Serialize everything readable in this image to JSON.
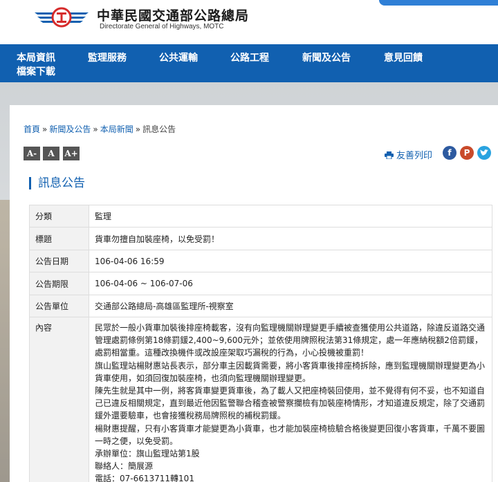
{
  "header": {
    "title_zh": "中華民國交通部公路總局",
    "title_en": "Directorate General of Highways, MOTC"
  },
  "nav": {
    "items": [
      "本局資訊",
      "監理服務",
      "公共運輸",
      "公路工程",
      "新聞及公告",
      "意見回饋",
      "檔案下載"
    ]
  },
  "breadcrumb": {
    "items": [
      "首頁",
      "新聞及公告",
      "本局新聞",
      "訊息公告"
    ],
    "sep": "»"
  },
  "toolbar": {
    "font_small": "A-",
    "font_medium": "A",
    "font_large": "A+",
    "print_label": "友善列印"
  },
  "page_title": "訊息公告",
  "info": {
    "category_label": "分類",
    "category_value": "監理",
    "title_label": "標題",
    "title_value": "貨車勿擅自加裝座椅，以免受罰！",
    "date_label": "公告日期",
    "date_value": "106-04-06 16:59",
    "period_label": "公告期限",
    "period_value": "106-04-06 ~ 106-07-06",
    "unit_label": "公告單位",
    "unit_value": "交通部公路總局-高雄區監理所-視察室",
    "content_label": "內容",
    "content": [
      "民眾於一般小貨車加裝後排座椅載客，沒有向監理機關辦理變更手續被查獲使用公共道路，除違反道路交通管理處罰條例第18條罰鍰2,400~9,600元外；並依使用牌照稅法第31條規定，處一年應納稅額2倍罰鍰，處罰相當重。這種改換機件或改設座架取巧漏稅的行為，小心投機被重罰！",
      "旗山監理站楊財惠站長表示，部分車主因載貨需要，將小客貨車後排座椅拆除，應到監理機關辦理變更為小貨車使用，如須回復加裝座椅，也須向監理機關辦理變更。",
      "陳先生就是其中一例，將客貨車變更貨車後，為了載人又把座椅裝回使用，並不覺得有何不妥，也不知道自己已違反相關規定，直到最近他因監警聯合稽查被警察攔檢有加裝座椅情形，才知道違反規定，除了交通罰鍰外還要驗車，也會接獲稅務局牌照稅的補稅罰鍰。",
      "楊財惠提醒，只有小客貨車才能變更為小貨車，也才能加裝座椅檢驗合格後變更回復小客貨車，千萬不要圖一時之便，以免受罰。",
      "承辦單位：旗山監理站第1股",
      "聯絡人：簡展源",
      "電話：07-6613711轉101"
    ]
  }
}
